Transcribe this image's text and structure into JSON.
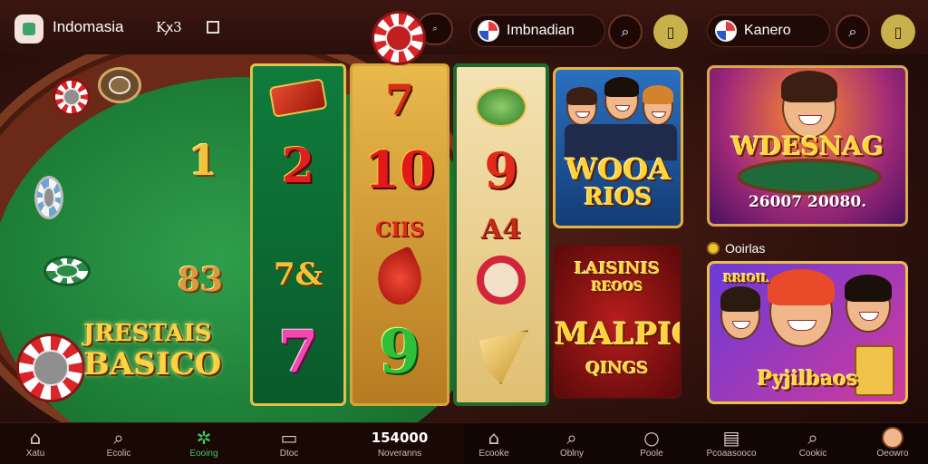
{
  "header": {
    "app_title": "Indomasia",
    "mini_label": "Kꭗ3",
    "center_pill_label": "Imbnadian",
    "right_pill_label": "Kanero",
    "search_glyph": "⌕",
    "menu_glyph": "▯"
  },
  "table": {
    "numbers": [
      "1",
      "83"
    ],
    "logo_line1": "JRESTAIS",
    "logo_line2": "BASICO"
  },
  "reels": {
    "reel1": [
      "2",
      "7&"
    ],
    "reel2": [
      "7",
      "10",
      "CIIS",
      "9"
    ],
    "reel3": [
      "9",
      "A4"
    ]
  },
  "cards": {
    "card1": {
      "line1": "WOOA",
      "line2": "RIOS"
    },
    "card2": {
      "line1": "WDESNAG",
      "line2": "26007 20080."
    },
    "card3": {
      "line1": "LAISINIS",
      "line2": "REOOS",
      "line3": "MALPIO",
      "line4": "QINGS"
    },
    "card4": {
      "line1": "RRIOIL",
      "line2": "Pyjilbaos"
    }
  },
  "section": {
    "label": "Ooirlas"
  },
  "nav": {
    "items": [
      {
        "label": "Xatu",
        "icon": "home-icon",
        "glyph": "⌂"
      },
      {
        "label": "Ecolic",
        "icon": "search-icon",
        "glyph": "⌕"
      },
      {
        "label": "Eooing",
        "icon": "games-icon",
        "glyph": "✲"
      },
      {
        "label": "Dtoc",
        "icon": "wallet-icon",
        "glyph": "▭"
      },
      {
        "label": "Noveranns",
        "value": "154000"
      },
      {
        "label": "Ecooke",
        "icon": "house-icon",
        "glyph": "⌂"
      },
      {
        "label": "Oblny",
        "icon": "search-icon",
        "glyph": "⌕"
      },
      {
        "label": "Poole",
        "icon": "circle-icon",
        "glyph": "○"
      },
      {
        "label": "Pcoaasooco",
        "icon": "doc-icon",
        "glyph": "▤"
      },
      {
        "label": "Cookic",
        "icon": "search-icon",
        "glyph": "⌕"
      },
      {
        "label": "Oeowro",
        "icon": "avatar-icon"
      }
    ]
  },
  "colors": {
    "accent_green": "#3fca63",
    "gold": "#ffd33a",
    "felt": "#1d7d36"
  }
}
